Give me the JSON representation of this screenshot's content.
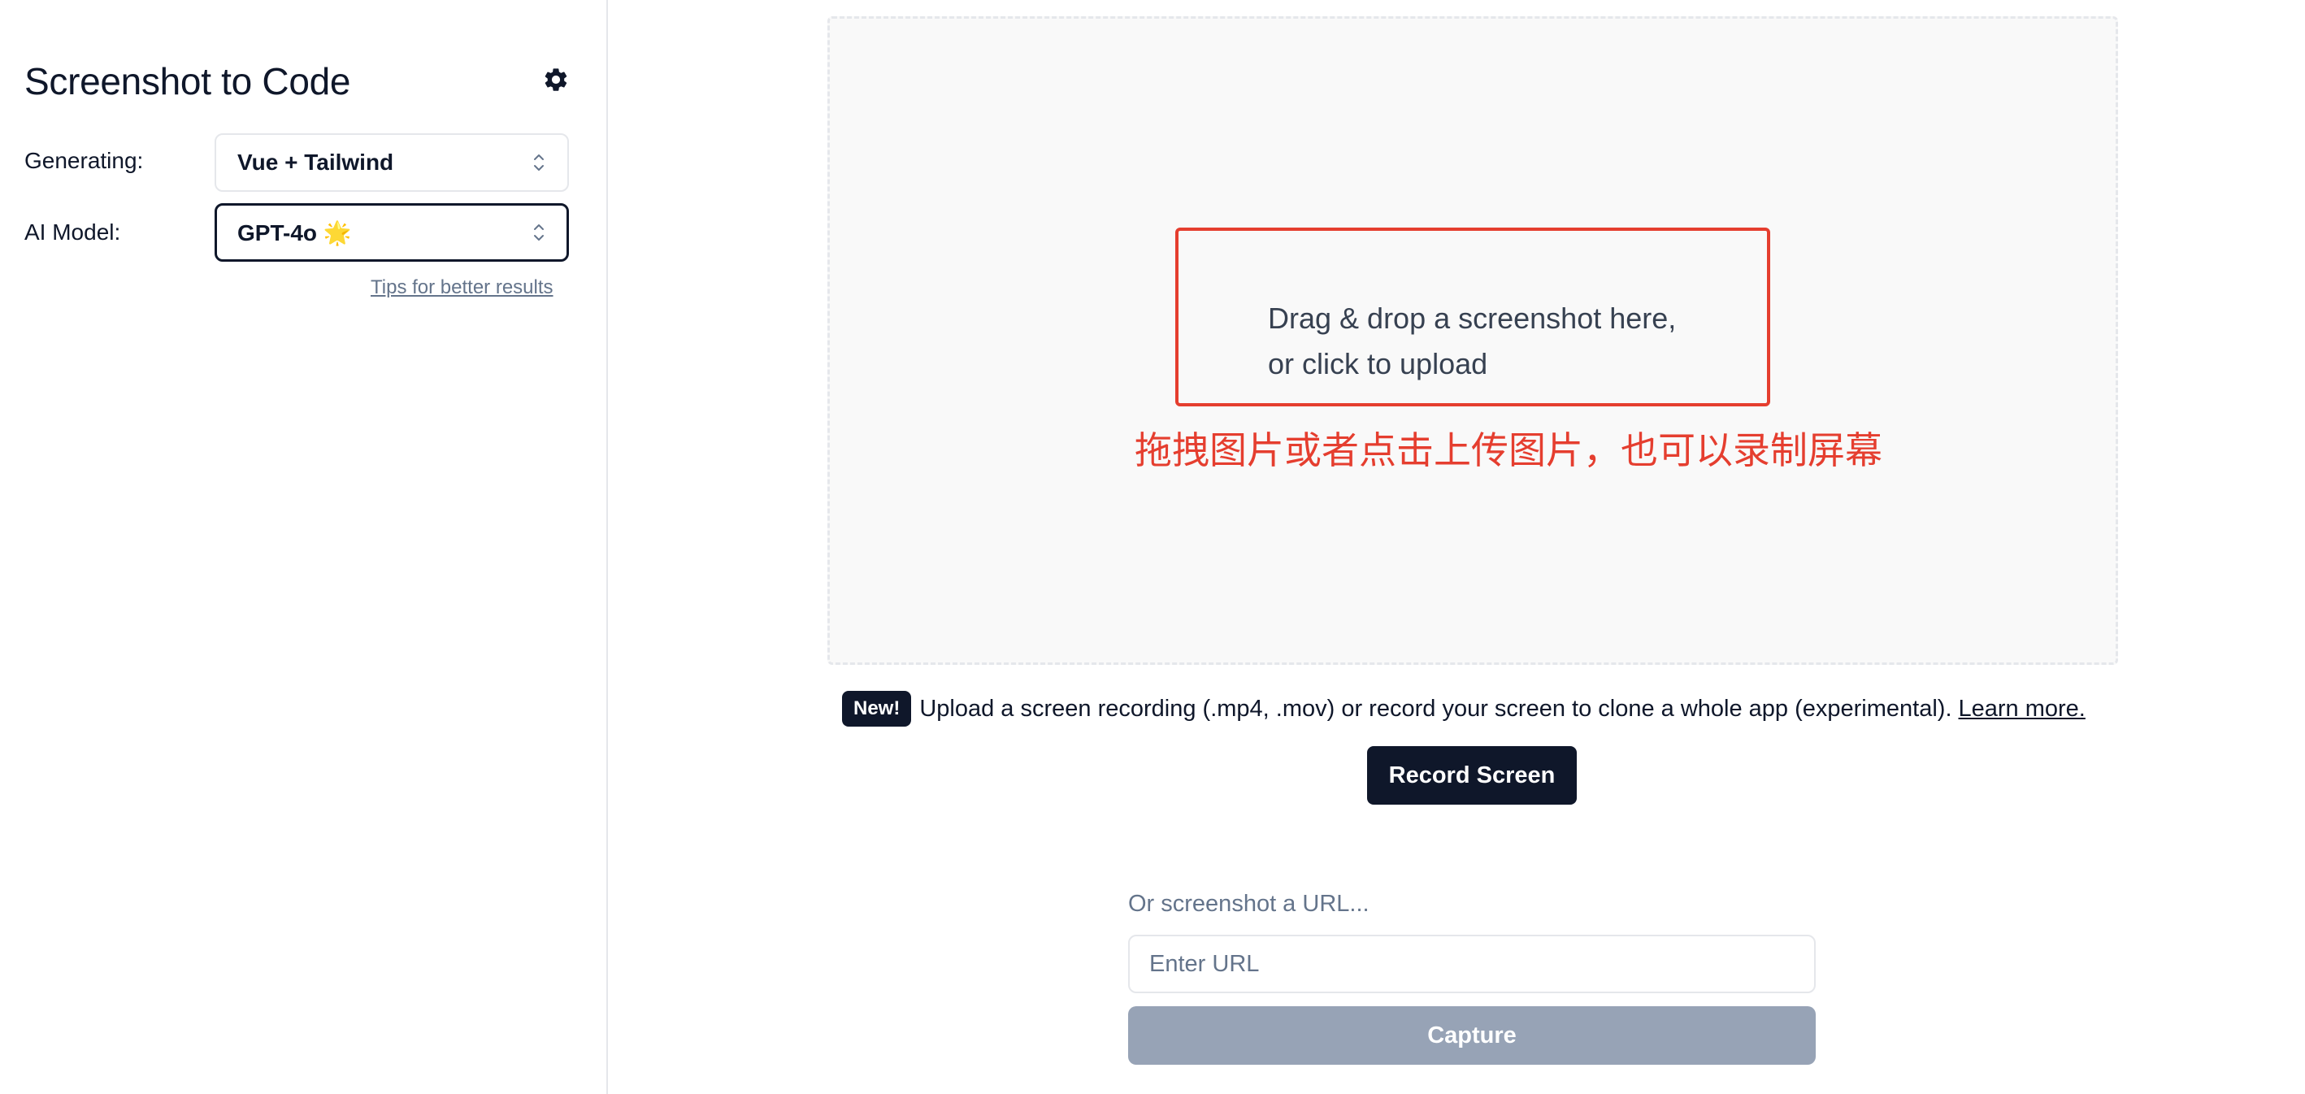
{
  "sidebar": {
    "title": "Screenshot to Code",
    "settings_icon": "gear-icon",
    "generating": {
      "label": "Generating:",
      "value": "Vue + Tailwind"
    },
    "model": {
      "label": "AI Model:",
      "value": "GPT-4o 🌟"
    },
    "tips_link": "Tips for better results"
  },
  "main": {
    "dropzone": {
      "text_line1": "Drag & drop a screenshot here,",
      "text_line2": "or click to upload"
    },
    "annotation": "拖拽图片或者点击上传图片，也可以录制屏幕",
    "recording": {
      "badge": "New!",
      "text": "Upload a screen recording (.mp4, .mov) or record your screen to clone a whole app (experimental).",
      "learn_more": "Learn more.",
      "record_button": "Record Screen"
    },
    "url": {
      "label": "Or screenshot a URL...",
      "placeholder": "Enter URL",
      "value": "",
      "capture_button": "Capture"
    }
  },
  "colors": {
    "primary": "#0f172a",
    "annotation_red": "#e53e2f",
    "muted_text": "#64748b",
    "border": "#e5e7eb",
    "dropzone_bg": "#f9f9f9",
    "capture_disabled": "#97a3b6"
  }
}
